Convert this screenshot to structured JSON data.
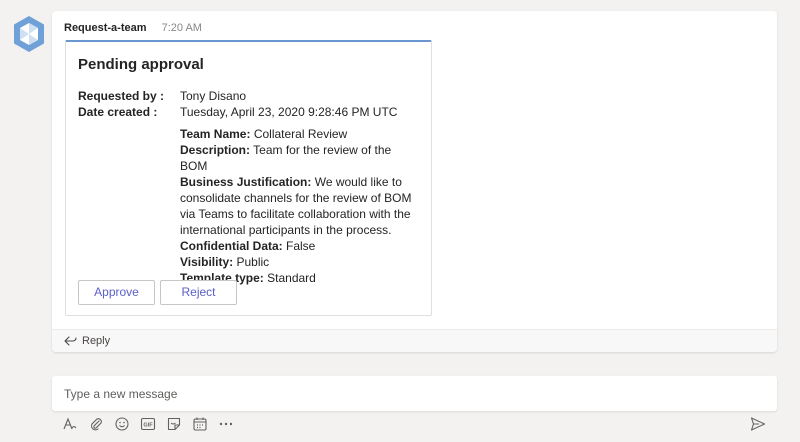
{
  "message": {
    "sender": "Request-a-team",
    "time": "7:20 AM"
  },
  "card": {
    "title": "Pending approval",
    "requested_by_label": "Requested by :",
    "requested_by_value": "Tony Disano",
    "date_created_label": "Date created :",
    "date_created_value": "Tuesday, April 23, 2020 9:28:46 PM UTC",
    "team_name_label": "Team Name:",
    "team_name_value": "Collateral Review",
    "description_label": "Description:",
    "description_value": "Team for the review of the BOM",
    "business_justification_label": "Business Justification:",
    "business_justification_value": "We would like to consolidate channels for the review of BOM via Teams to facilitate collaboration with the international participants in the process.",
    "confidential_label": "Confidential Data:",
    "confidential_value": "False",
    "visibility_label": "Visibility:",
    "visibility_value": "Public",
    "template_type_label": "Template type:",
    "template_type_value": "Standard",
    "approve_label": "Approve",
    "reject_label": "Reject"
  },
  "reply": {
    "label": "Reply",
    "icon": "reply-arrow-icon"
  },
  "compose": {
    "placeholder": "Type a new message"
  },
  "toolbar": {
    "icons": [
      "format-icon",
      "attach-icon",
      "emoji-icon",
      "gif-icon",
      "sticker-icon",
      "schedule-meeting-icon",
      "more-options-icon"
    ],
    "send_icon": "send-icon"
  },
  "colors": {
    "accent": "#5b5fc7",
    "card_top_border": "#6b97d1",
    "background": "#f3f2f1",
    "avatar": "#6fa0d8"
  }
}
